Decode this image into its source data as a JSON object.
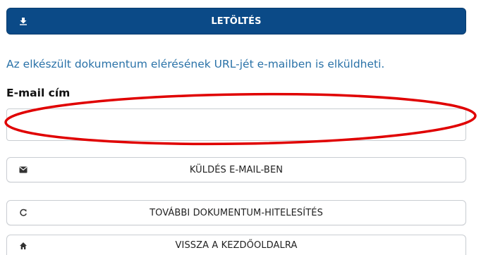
{
  "download": {
    "label": "LETÖLTÉS",
    "icon": "download-icon",
    "color": "#0b4a87"
  },
  "info_text": "Az elkészült dokumentum elérésének URL-jét e-mailben is elküldheti.",
  "email": {
    "label": "E-mail cím",
    "value": "",
    "placeholder": ""
  },
  "actions": {
    "send_email": {
      "label": "KÜLDÉS E-MAIL-BEN",
      "icon": "envelope-icon"
    },
    "another_authentication": {
      "label": "TOVÁBBI DOKUMENTUM-HITELESÍTÉS",
      "icon": "refresh-icon"
    },
    "back_home": {
      "label": "VISSZA A KEZDŐOLDALRA",
      "icon": "home-icon"
    }
  },
  "annotation": {
    "shape": "ellipse",
    "color": "#e00000"
  }
}
